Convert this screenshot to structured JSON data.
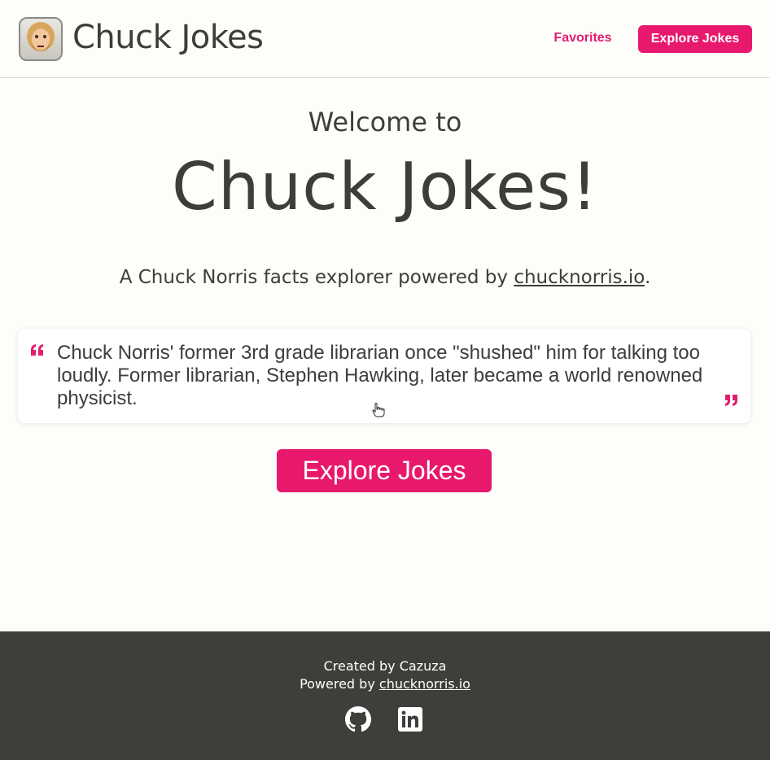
{
  "header": {
    "brand": "Chuck Jokes",
    "logo_icon": "chuck-avatar-icon",
    "nav": {
      "favorites_label": "Favorites",
      "explore_label": "Explore Jokes"
    }
  },
  "hero": {
    "welcome": "Welcome to",
    "title": "Chuck Jokes!",
    "subtitle_prefix": "A Chuck Norris facts explorer powered by ",
    "subtitle_link": "chucknorris.io",
    "subtitle_suffix": "."
  },
  "quote": {
    "text": "Chuck Norris' former 3rd grade librarian once \"shushed\" him for talking too loudly. Former librarian, Stephen Hawking, later became a world renowned physicist.",
    "open_icon": "quote-open-icon",
    "close_icon": "quote-close-icon"
  },
  "cta": {
    "label": "Explore Jokes"
  },
  "footer": {
    "created_by": "Created by Cazuza",
    "powered_prefix": "Powered by ",
    "powered_link": "chucknorris.io",
    "icons": [
      "github-icon",
      "linkedin-icon"
    ]
  },
  "colors": {
    "accent": "#e8186d",
    "text": "#3d3d3a",
    "background": "#fdfdf9",
    "footer_bg": "#3e3e3b"
  }
}
